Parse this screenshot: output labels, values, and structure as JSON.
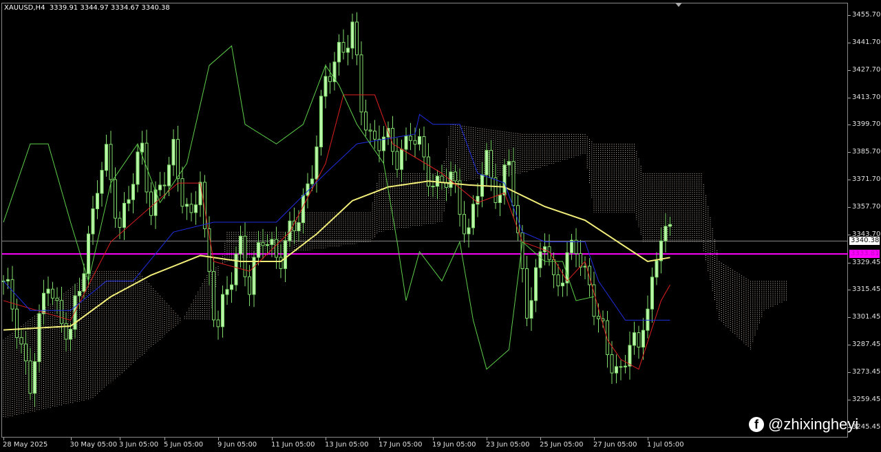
{
  "header": {
    "symbol": "XAUUSD,H4",
    "ohlc": "3339.91 3344.97 3334.67 3340.38"
  },
  "watermark": {
    "text": "@zhixingheyi",
    "icon": "facebook-icon"
  },
  "colors": {
    "bull": "#b8f5a8",
    "bear": "#000000",
    "wick": "#7fdc6a",
    "ma": "#f2ee7a",
    "kijun": "#e02020",
    "tenkan": "#1e2ee0",
    "chikou": "#5ed04a",
    "cloud": "#c9b8a8",
    "bid_line": "#8a8a8a",
    "alert_line": "#ff00ff"
  },
  "chart_data": {
    "type": "candlestick",
    "title": "XAUUSD,H4",
    "x_unit": "bar index (H4)",
    "bars": 150,
    "ylim": [
      3240,
      3462
    ],
    "y_ticks": [
      "3455.70",
      "3441.70",
      "3427.70",
      "3413.70",
      "3399.70",
      "3385.70",
      "3371.70",
      "3357.70",
      "3343.70",
      "3329.45",
      "3315.45",
      "3301.45",
      "3287.45",
      "3273.45",
      "3259.45",
      "3245.45"
    ],
    "x_ticks": [
      {
        "bar": 0,
        "label": "28 May 2025"
      },
      {
        "bar": 15,
        "label": "30 May 05:00"
      },
      {
        "bar": 26,
        "label": "3 Jun 05:00"
      },
      {
        "bar": 36,
        "label": "5 Jun 05:00"
      },
      {
        "bar": 48,
        "label": "9 Jun 05:00"
      },
      {
        "bar": 60,
        "label": "11 Jun 05:00"
      },
      {
        "bar": 72,
        "label": "13 Jun 05:00"
      },
      {
        "bar": 84,
        "label": "17 Jun 05:00"
      },
      {
        "bar": 96,
        "label": "19 Jun 05:00"
      },
      {
        "bar": 108,
        "label": "23 Jun 05:00"
      },
      {
        "bar": 120,
        "label": "25 Jun 05:00"
      },
      {
        "bar": 132,
        "label": "27 Jun 05:00"
      },
      {
        "bar": 144,
        "label": "1 Jul 05:00"
      }
    ],
    "bid_price": "3340.38",
    "alert_price": "3333.81",
    "close_path": [
      [
        0,
        3320
      ],
      [
        6,
        3270
      ],
      [
        10,
        3320
      ],
      [
        15,
        3290
      ],
      [
        18,
        3330
      ],
      [
        21,
        3370
      ],
      [
        23,
        3380
      ],
      [
        26,
        3350
      ],
      [
        31,
        3385
      ],
      [
        33,
        3360
      ],
      [
        37,
        3375
      ],
      [
        38,
        3385
      ],
      [
        42,
        3350
      ],
      [
        44,
        3370
      ],
      [
        45,
        3340
      ],
      [
        47,
        3310
      ],
      [
        48,
        3300
      ],
      [
        51,
        3320
      ],
      [
        53,
        3340
      ],
      [
        55,
        3320
      ],
      [
        58,
        3340
      ],
      [
        62,
        3335
      ],
      [
        65,
        3345
      ],
      [
        68,
        3370
      ],
      [
        70,
        3390
      ],
      [
        72,
        3420
      ],
      [
        75,
        3440
      ],
      [
        78,
        3445
      ],
      [
        80,
        3410
      ],
      [
        82,
        3395
      ],
      [
        85,
        3390
      ],
      [
        88,
        3385
      ],
      [
        91,
        3395
      ],
      [
        94,
        3380
      ],
      [
        97,
        3370
      ],
      [
        100,
        3370
      ],
      [
        102,
        3360
      ],
      [
        104,
        3345
      ],
      [
        106,
        3365
      ],
      [
        108,
        3380
      ],
      [
        111,
        3365
      ],
      [
        113,
        3380
      ],
      [
        115,
        3340
      ],
      [
        117,
        3310
      ],
      [
        119,
        3320
      ],
      [
        121,
        3340
      ],
      [
        123,
        3320
      ],
      [
        126,
        3330
      ],
      [
        128,
        3335
      ],
      [
        131,
        3320
      ],
      [
        133,
        3300
      ],
      [
        135,
        3280
      ],
      [
        138,
        3275
      ],
      [
        140,
        3290
      ],
      [
        142,
        3280
      ],
      [
        143,
        3300
      ],
      [
        145,
        3320
      ],
      [
        147,
        3345
      ],
      [
        149,
        3340
      ]
    ],
    "series": [
      {
        "name": "Moving Average",
        "color_key": "ma",
        "points": [
          [
            0,
            3295
          ],
          [
            15,
            3297
          ],
          [
            24,
            3312
          ],
          [
            33,
            3323
          ],
          [
            44,
            3333
          ],
          [
            53,
            3330
          ],
          [
            62,
            3330
          ],
          [
            70,
            3344
          ],
          [
            78,
            3361
          ],
          [
            86,
            3368
          ],
          [
            95,
            3371
          ],
          [
            104,
            3369
          ],
          [
            112,
            3368
          ],
          [
            121,
            3358
          ],
          [
            130,
            3351
          ],
          [
            138,
            3339
          ],
          [
            144,
            3330
          ],
          [
            149,
            3332
          ]
        ]
      },
      {
        "name": "Kijun-sen",
        "color_key": "kijun",
        "points": [
          [
            0,
            3310
          ],
          [
            15,
            3300
          ],
          [
            24,
            3340
          ],
          [
            39,
            3370
          ],
          [
            44,
            3370
          ],
          [
            47,
            3330
          ],
          [
            55,
            3325
          ],
          [
            64,
            3345
          ],
          [
            72,
            3380
          ],
          [
            76,
            3415
          ],
          [
            83,
            3415
          ],
          [
            87,
            3390
          ],
          [
            98,
            3375
          ],
          [
            106,
            3360
          ],
          [
            112,
            3365
          ],
          [
            116,
            3340
          ],
          [
            122,
            3335
          ],
          [
            126,
            3320
          ],
          [
            130,
            3330
          ],
          [
            135,
            3290
          ],
          [
            138,
            3280
          ],
          [
            142,
            3275
          ],
          [
            147,
            3310
          ],
          [
            149,
            3318
          ]
        ]
      },
      {
        "name": "Tenkan-sen",
        "color_key": "tenkan",
        "points": [
          [
            0,
            3320
          ],
          [
            6,
            3305
          ],
          [
            15,
            3305
          ],
          [
            23,
            3320
          ],
          [
            29,
            3320
          ],
          [
            38,
            3345
          ],
          [
            47,
            3350
          ],
          [
            61,
            3350
          ],
          [
            72,
            3375
          ],
          [
            79,
            3390
          ],
          [
            92,
            3395
          ],
          [
            93,
            3405
          ],
          [
            96,
            3400
          ],
          [
            102,
            3400
          ],
          [
            106,
            3375
          ],
          [
            112,
            3370
          ],
          [
            116,
            3345
          ],
          [
            121,
            3340
          ],
          [
            130,
            3340
          ],
          [
            133,
            3320
          ],
          [
            139,
            3300
          ],
          [
            149,
            3300
          ]
        ]
      },
      {
        "name": "Chikou Span",
        "color_key": "chikou",
        "points": [
          [
            0,
            3350
          ],
          [
            6,
            3390
          ],
          [
            10,
            3390
          ],
          [
            15,
            3350
          ],
          [
            19,
            3320
          ],
          [
            24,
            3370
          ],
          [
            30,
            3390
          ],
          [
            35,
            3360
          ],
          [
            41,
            3380
          ],
          [
            46,
            3430
          ],
          [
            51,
            3440
          ],
          [
            54,
            3400
          ],
          [
            61,
            3390
          ],
          [
            67,
            3400
          ],
          [
            72,
            3430
          ],
          [
            75,
            3420
          ],
          [
            79,
            3400
          ],
          [
            85,
            3380
          ],
          [
            88,
            3340
          ],
          [
            90,
            3310
          ],
          [
            93,
            3335
          ],
          [
            98,
            3320
          ],
          [
            102,
            3340
          ],
          [
            105,
            3300
          ],
          [
            108,
            3275
          ],
          [
            113,
            3285
          ],
          [
            116,
            3340
          ],
          [
            121,
            3330
          ],
          [
            125,
            3330
          ],
          [
            128,
            3310
          ],
          [
            132,
            3312
          ]
        ]
      }
    ],
    "cloud": [
      [
        0,
        3250,
        3290
      ],
      [
        20,
        3260,
        3325
      ],
      [
        30,
        3280,
        3325
      ],
      [
        40,
        3300,
        3300
      ],
      [
        46,
        3325,
        3300
      ],
      [
        50,
        3330,
        3345
      ],
      [
        64,
        3335,
        3345
      ],
      [
        66,
        3335,
        3355
      ],
      [
        82,
        3340,
        3355
      ],
      [
        84,
        3345,
        3375
      ],
      [
        98,
        3350,
        3375
      ],
      [
        100,
        3370,
        3400
      ],
      [
        116,
        3375,
        3395
      ],
      [
        130,
        3385,
        3395
      ],
      [
        132,
        3355,
        3390
      ],
      [
        141,
        3355,
        3390
      ],
      [
        143,
        3340,
        3375
      ],
      [
        156,
        3340,
        3375
      ],
      [
        160,
        3300,
        3330
      ],
      [
        167,
        3285,
        3320
      ],
      [
        170,
        3305,
        3320
      ],
      [
        175,
        3310,
        3320
      ]
    ]
  }
}
